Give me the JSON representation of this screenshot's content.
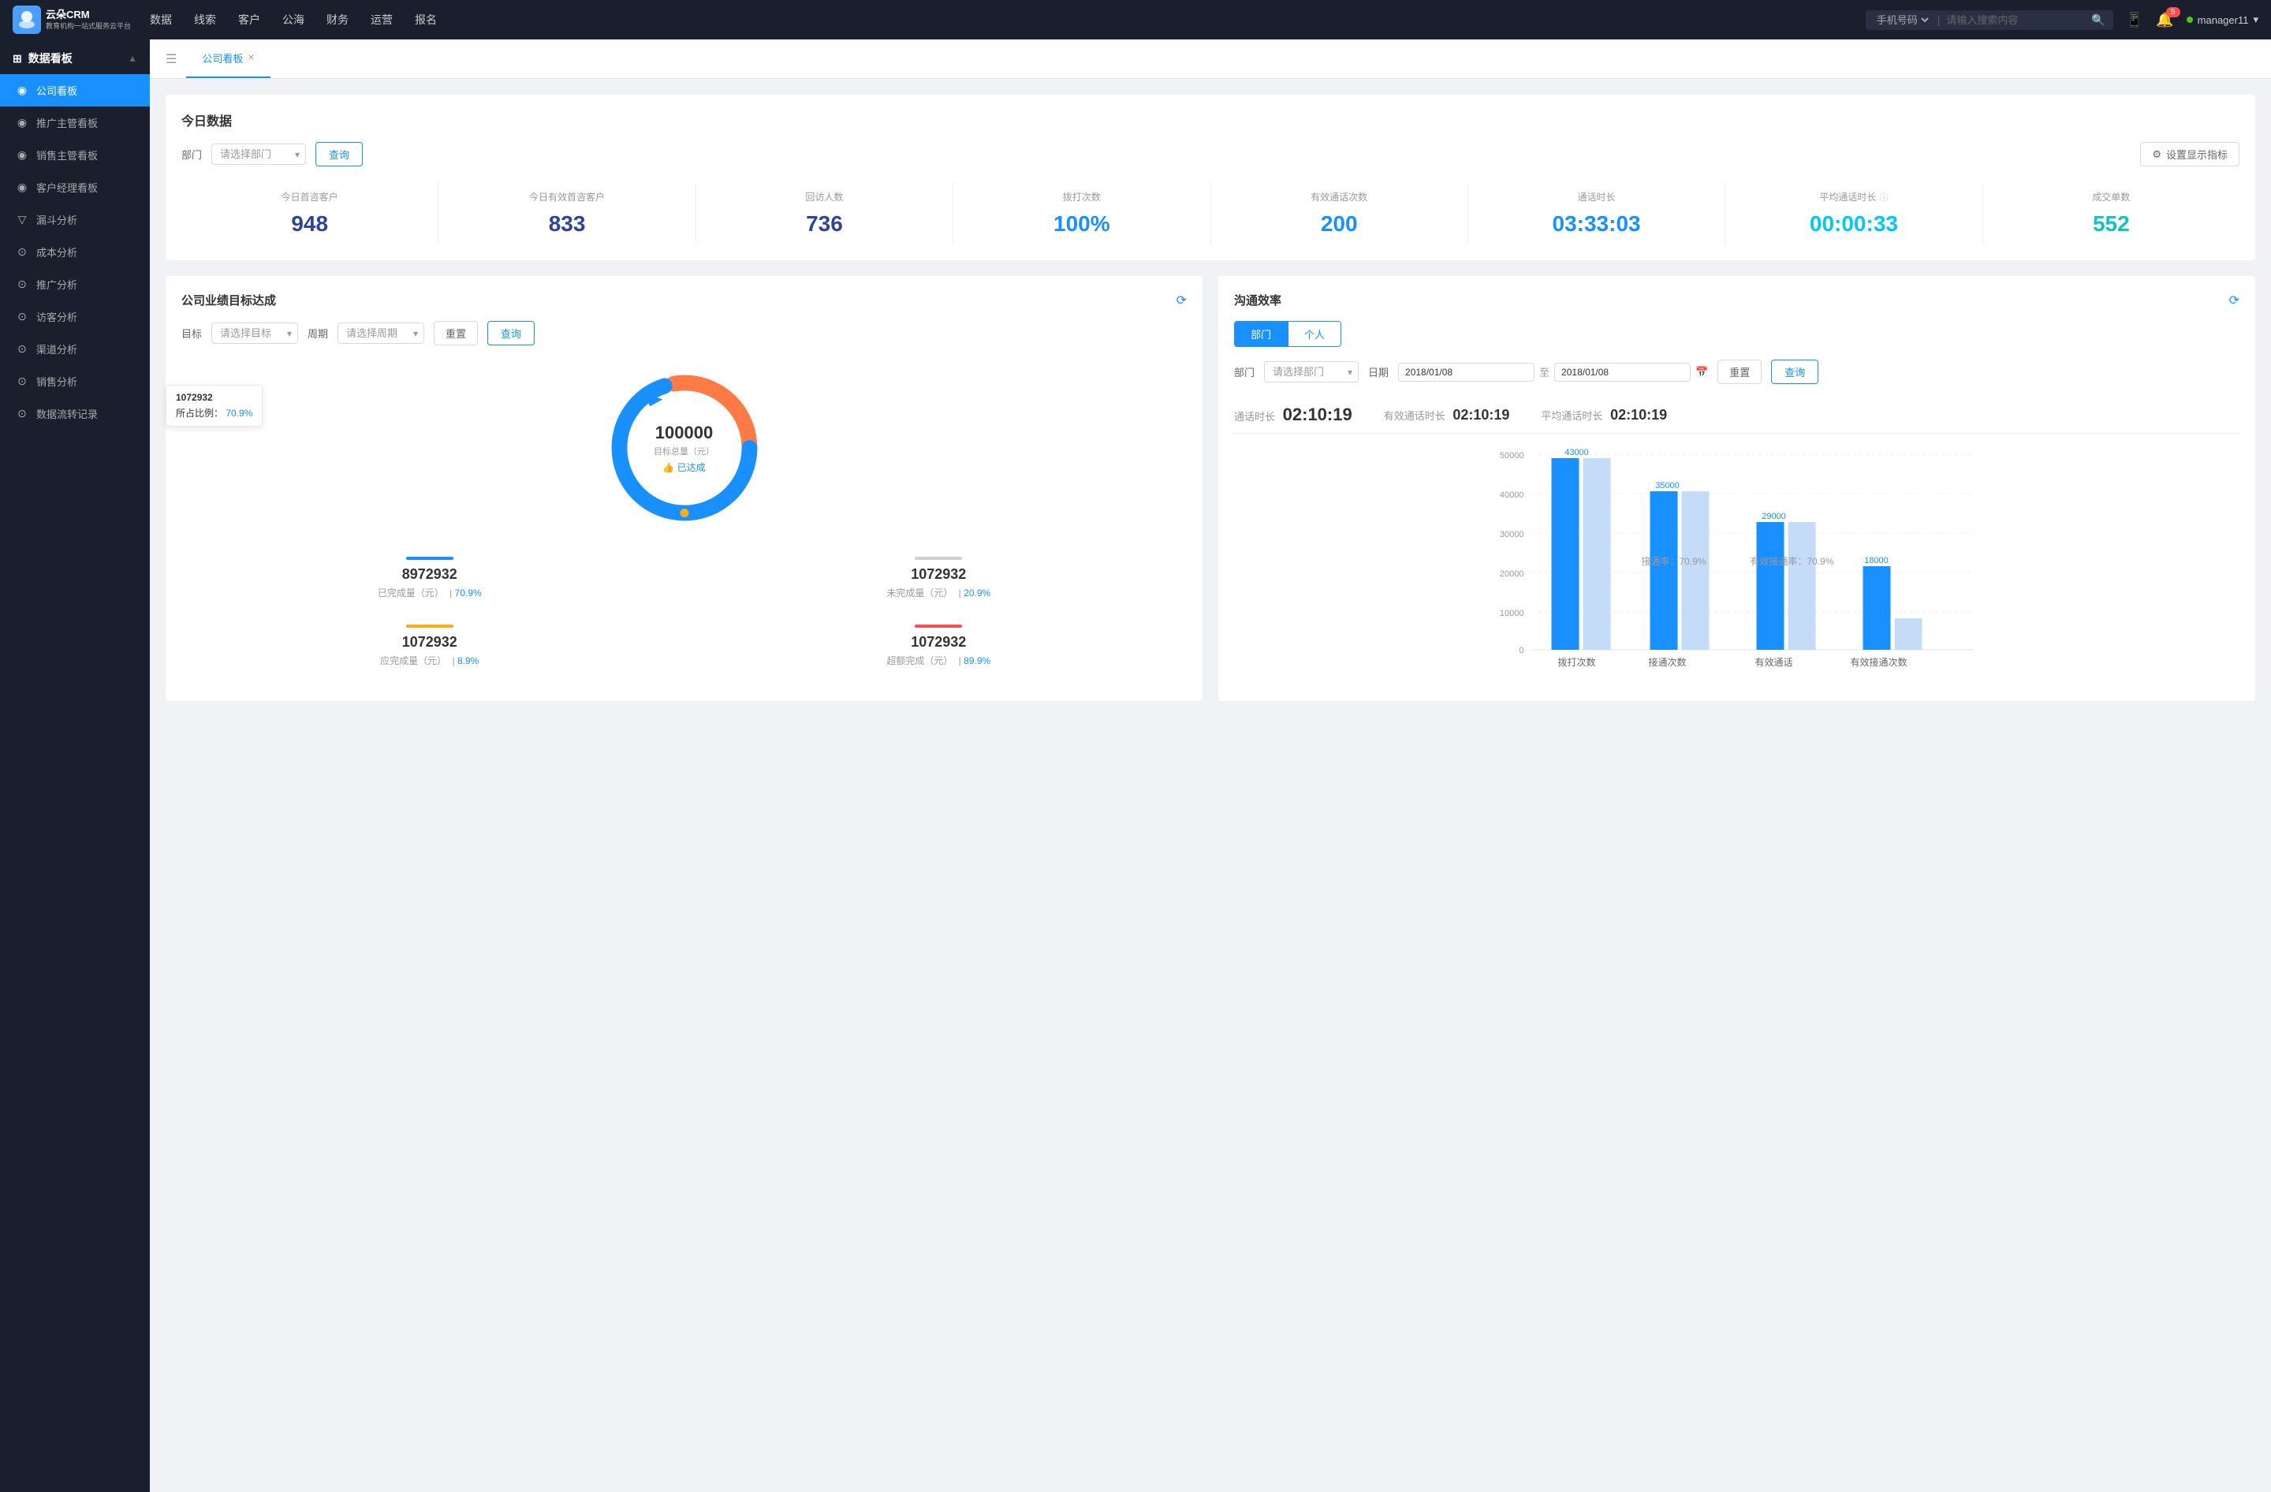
{
  "app": {
    "logo_text_line1": "云朵CRM",
    "logo_text_line2": "教育机构一站式服务云平台"
  },
  "top_nav": {
    "items": [
      "数据",
      "线索",
      "客户",
      "公海",
      "财务",
      "运营",
      "报名"
    ],
    "search_placeholder": "请输入搜索内容",
    "search_select": "手机号码",
    "notification_count": "5",
    "user_name": "manager11"
  },
  "sidebar": {
    "section_title": "数据看板",
    "items": [
      {
        "label": "公司看板",
        "active": true
      },
      {
        "label": "推广主管看板",
        "active": false
      },
      {
        "label": "销售主管看板",
        "active": false
      },
      {
        "label": "客户经理看板",
        "active": false
      },
      {
        "label": "漏斗分析",
        "active": false
      },
      {
        "label": "成本分析",
        "active": false
      },
      {
        "label": "推广分析",
        "active": false
      },
      {
        "label": "访客分析",
        "active": false
      },
      {
        "label": "渠道分析",
        "active": false
      },
      {
        "label": "销售分析",
        "active": false
      },
      {
        "label": "数据流转记录",
        "active": false
      }
    ]
  },
  "tab_bar": {
    "active_tab": "公司看板"
  },
  "today_section": {
    "title": "今日数据",
    "filter_label": "部门",
    "filter_placeholder": "请选择部门",
    "query_btn": "查询",
    "settings_btn": "设置显示指标",
    "metrics": [
      {
        "label": "今日首咨客户",
        "value": "948",
        "color": "dark-blue"
      },
      {
        "label": "今日有效首咨客户",
        "value": "833",
        "color": "dark-blue"
      },
      {
        "label": "回访人数",
        "value": "736",
        "color": "dark-blue"
      },
      {
        "label": "拨打次数",
        "value": "100%",
        "color": "blue"
      },
      {
        "label": "有效通话次数",
        "value": "200",
        "color": "blue"
      },
      {
        "label": "通话时长",
        "value": "03:33:03",
        "color": "blue"
      },
      {
        "label": "平均通话时长",
        "value": "00:00:33",
        "color": "cyan"
      },
      {
        "label": "成交单数",
        "value": "552",
        "color": "teal"
      }
    ]
  },
  "left_panel": {
    "title": "公司业绩目标达成",
    "filter_target_label": "目标",
    "filter_target_placeholder": "请选择目标",
    "filter_period_label": "周期",
    "filter_period_placeholder": "请选择周期",
    "reset_btn": "重置",
    "query_btn": "查询",
    "donut": {
      "value": "100000",
      "label": "目标总量（元）",
      "achieved_label": "👍 已达成",
      "tooltip_value": "1072932",
      "tooltip_pct_label": "所占比例：",
      "tooltip_pct": "70.9%"
    },
    "metrics": [
      {
        "color": "#1890ff",
        "value": "8972932",
        "desc": "已完成量（元）",
        "pct": "70.9%"
      },
      {
        "color": "#d0d0d0",
        "value": "1072932",
        "desc": "未完成量（元）",
        "pct": "20.9%"
      },
      {
        "color": "#faad14",
        "value": "1072932",
        "desc": "应完成量（元）",
        "pct": "8.9%"
      },
      {
        "color": "#ff4d4f",
        "value": "1072932",
        "desc": "超额完成（元）",
        "pct": "89.9%"
      }
    ]
  },
  "right_panel": {
    "title": "沟通效率",
    "tabs": [
      "部门",
      "个人"
    ],
    "active_tab": "部门",
    "filter_dept_label": "部门",
    "filter_dept_placeholder": "请选择部门",
    "filter_date_label": "日期",
    "date_from": "2018/01/08",
    "date_to": "2018/01/08",
    "reset_btn": "重置",
    "query_btn": "查询",
    "stats": {
      "call_duration_label": "通话时长",
      "call_duration_value": "02:10:19",
      "effective_label": "有效通话时长",
      "effective_value": "02:10:19",
      "avg_label": "平均通话时长",
      "avg_value": "02:10:19"
    },
    "chart": {
      "y_labels": [
        "50000",
        "40000",
        "30000",
        "20000",
        "10000",
        "0"
      ],
      "groups": [
        {
          "x_label": "拨打次数",
          "bars": [
            {
              "value": 43000,
              "label": "43000",
              "color": "#1890ff"
            },
            {
              "value": 0,
              "label": "",
              "color": "#a0c4ff"
            }
          ]
        },
        {
          "x_label": "接通次数",
          "bars": [
            {
              "value": 35000,
              "label": "35000",
              "color": "#1890ff"
            },
            {
              "value": 0,
              "label": "",
              "color": "#a0c4ff"
            }
          ],
          "annotation": "接通率：70.9%"
        },
        {
          "x_label": "有效通话",
          "bars": [
            {
              "value": 29000,
              "label": "29000",
              "color": "#1890ff"
            },
            {
              "value": 0,
              "label": "",
              "color": "#a0c4ff"
            }
          ],
          "annotation": "有效接通率：70.9%"
        },
        {
          "x_label": "有效接通次数",
          "bars": [
            {
              "value": 18000,
              "label": "18000",
              "color": "#1890ff"
            },
            {
              "value": 4000,
              "label": "",
              "color": "#a0c4ff"
            }
          ]
        }
      ]
    }
  }
}
